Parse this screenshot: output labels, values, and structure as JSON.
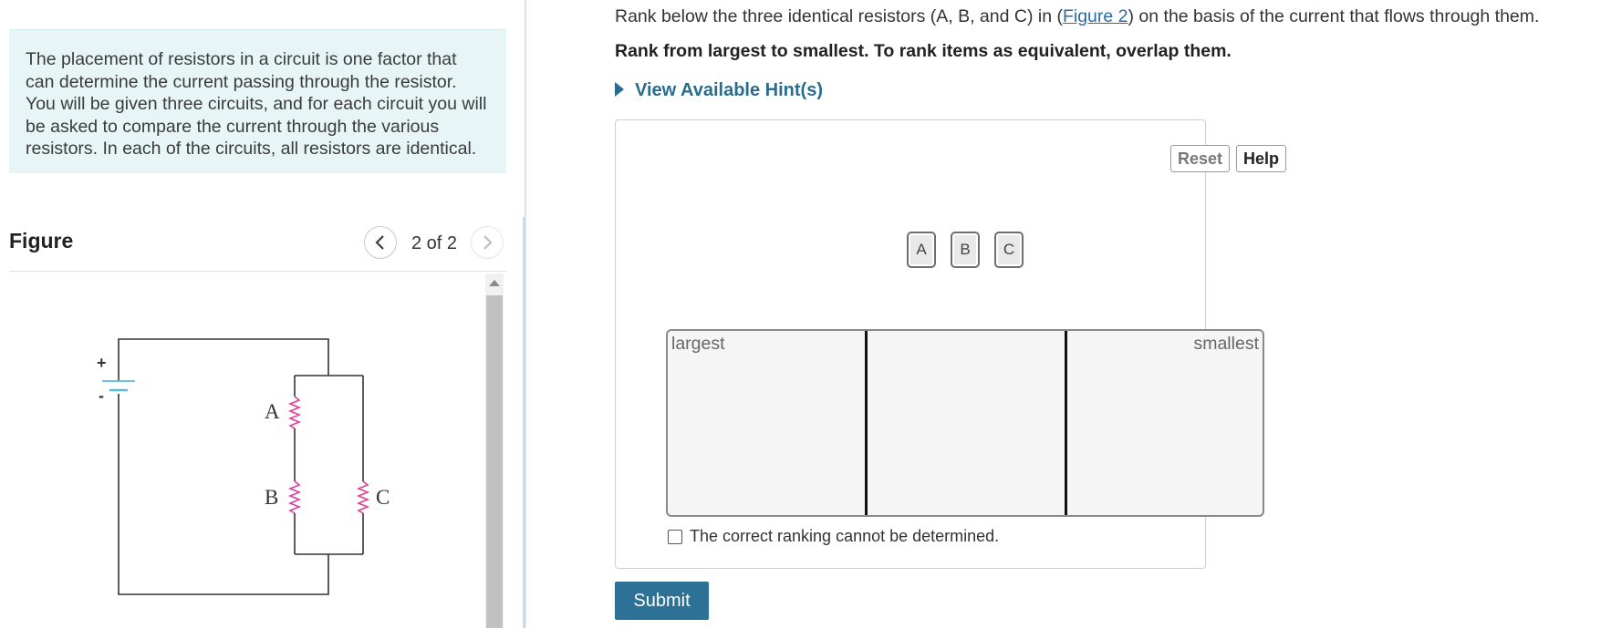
{
  "intro": {
    "text": "The placement of resistors in a circuit is one factor that can determine the current passing through the resistor. You will be given three circuits, and for each circuit you will be asked to compare the current through the various resistors. In each of the circuits, all resistors are identical."
  },
  "figure": {
    "title": "Figure",
    "page_counter": "2 of 2",
    "prev_icon": "chevron-left-icon",
    "next_icon": "chevron-right-icon",
    "circuit": {
      "labels": {
        "a": "A",
        "b": "B",
        "c": "C"
      },
      "battery_positive": "+",
      "battery_negative": "-",
      "resistor_color": "#e0409a",
      "battery_color": "#5bb8dd"
    }
  },
  "question": {
    "prefix": "Rank below the three identical resistors (A, B, and C) in (",
    "link": "Figure 2",
    "suffix": ") on the basis of the current that flows through them.",
    "instruction": "Rank from largest to smallest. To rank items as equivalent, overlap them."
  },
  "hints": {
    "label": "View Available Hint(s)"
  },
  "toolbar": {
    "reset_label": "Reset",
    "help_label": "Help"
  },
  "tiles": [
    "A",
    "B",
    "C"
  ],
  "ranking": {
    "left_label": "largest",
    "right_label": "smallest"
  },
  "cannot_determine": {
    "label": "The correct ranking cannot be determined.",
    "checked": false
  },
  "submit": {
    "label": "Submit"
  },
  "colors": {
    "accent": "#2d7196",
    "intro_bg": "#e8f5f6",
    "link": "#2a6aa8"
  }
}
